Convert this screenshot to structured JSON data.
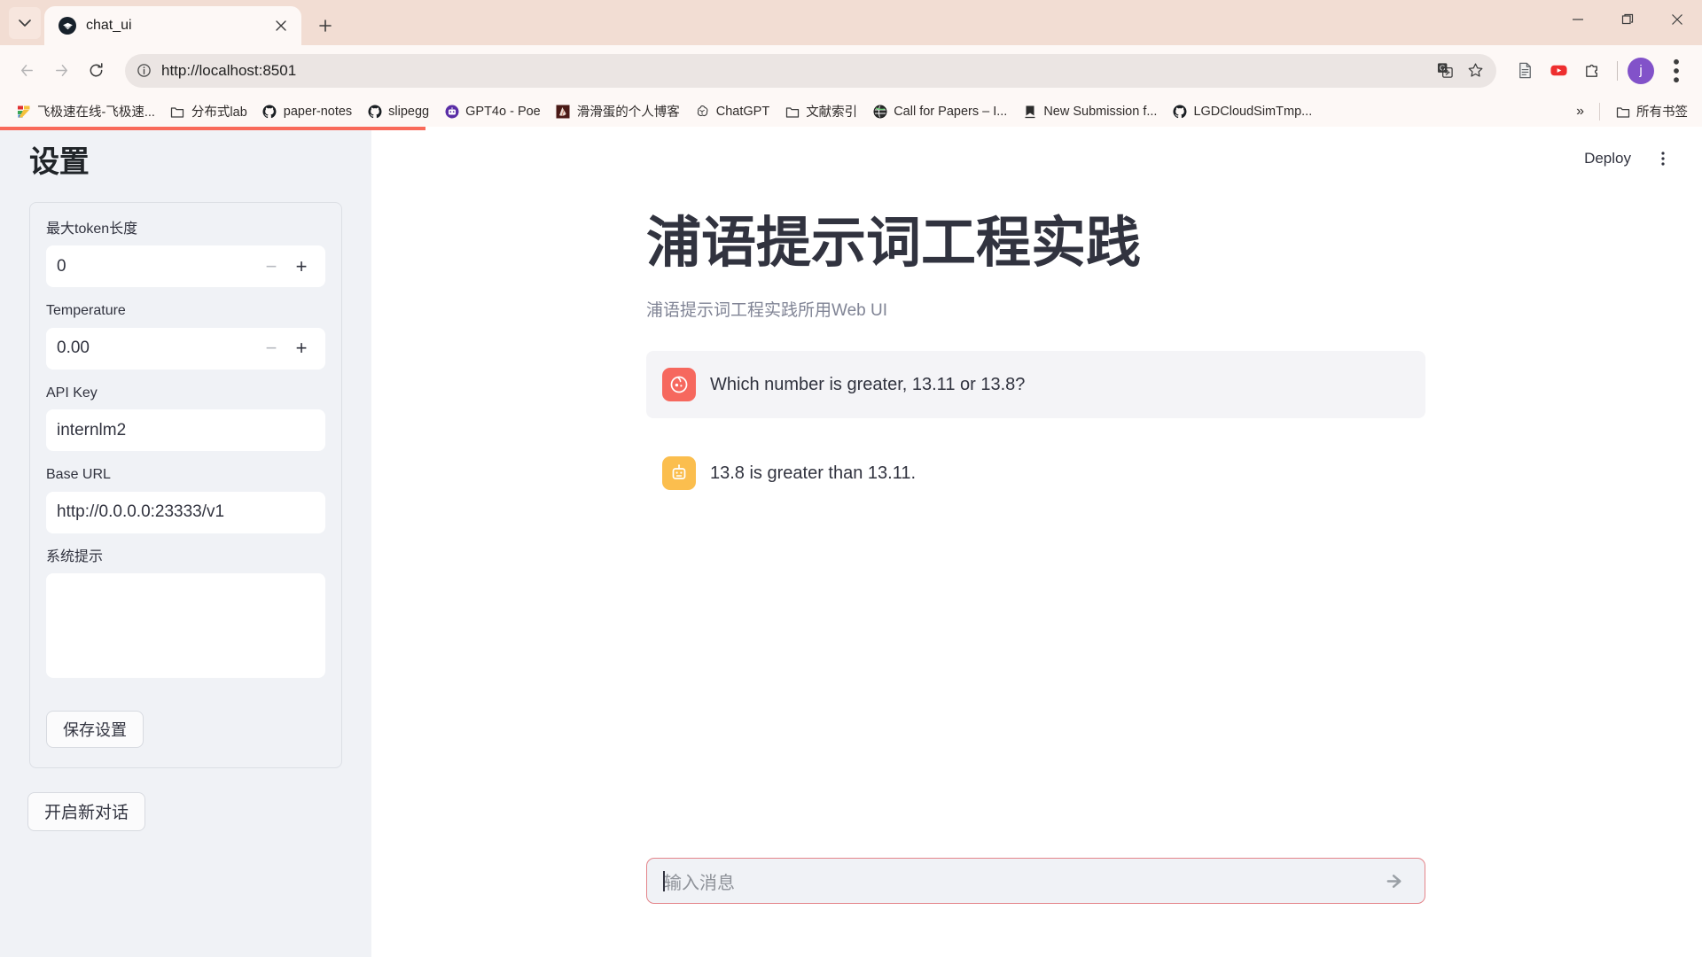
{
  "browser": {
    "tab": {
      "title": "chat_ui",
      "favicon": "streamlit-favicon"
    },
    "new_tab_label": "+",
    "window_controls": [
      "minimize",
      "maximize",
      "close"
    ],
    "nav": {
      "back": "back-arrow",
      "forward": "forward-arrow",
      "reload": "reload-icon"
    },
    "omnibox": {
      "url": "http://localhost:8501",
      "info_icon": "site-info-icon",
      "translate_icon": "translate-icon",
      "bookmark_icon": "star-icon"
    },
    "extensions": [
      "reading-list-icon",
      "youtube-icon",
      "extensions-puzzle-icon"
    ],
    "profile": {
      "initial": "j",
      "color": "#8252c9"
    },
    "menu_icon": "kebab-menu-icon",
    "bookmarks": [
      {
        "label": "飞极速在线-飞极速...",
        "icon": "z-logo-icon"
      },
      {
        "label": "分布式lab",
        "icon": "folder-icon"
      },
      {
        "label": "paper-notes",
        "icon": "github-icon"
      },
      {
        "label": "slipegg",
        "icon": "github-icon"
      },
      {
        "label": "GPT4o - Poe",
        "icon": "poe-icon"
      },
      {
        "label": "滑滑蛋的个人博客",
        "icon": "blog-icon"
      },
      {
        "label": "ChatGPT",
        "icon": "openai-icon"
      },
      {
        "label": "文献索引",
        "icon": "folder-icon"
      },
      {
        "label": "Call for Papers – I...",
        "icon": "globe-icon"
      },
      {
        "label": "New Submission f...",
        "icon": "bookmark-ribbon-icon"
      },
      {
        "label": "LGDCloudSimTmp...",
        "icon": "github-icon"
      }
    ],
    "bookmarks_overflow": "»",
    "all_bookmarks": {
      "label": "所有书签",
      "icon": "folder-icon"
    }
  },
  "sidebar": {
    "title": "设置",
    "fields": {
      "max_token": {
        "label": "最大token长度",
        "value": "0",
        "minus": "−",
        "plus": "+"
      },
      "temperature": {
        "label": "Temperature",
        "value": "0.00",
        "minus": "−",
        "plus": "+"
      },
      "api_key": {
        "label": "API Key",
        "value": "internlm2"
      },
      "base_url": {
        "label": "Base URL",
        "value": "http://0.0.0.0:23333/v1"
      },
      "system_prompt": {
        "label": "系统提示",
        "value": ""
      }
    },
    "save_button": "保存设置",
    "new_chat_button": "开启新对话"
  },
  "main": {
    "deploy_button": "Deploy",
    "kebab_menu": "main-menu-icon",
    "title": "浦语提示词工程实践",
    "subtitle": "浦语提示词工程实践所用Web UI",
    "messages": [
      {
        "role": "user",
        "avatar": "user-avatar-icon",
        "avatar_color": "#f6685e",
        "text": "Which number is greater, 13.11 or 13.8?"
      },
      {
        "role": "assistant",
        "avatar": "robot-avatar-icon",
        "avatar_color": "#fbbe4e",
        "text": "13.8 is greater than 13.11."
      }
    ],
    "chat_input": {
      "placeholder": "输入消息",
      "value": "",
      "send_icon": "send-arrow-icon",
      "border_color": "#e4848a"
    }
  }
}
